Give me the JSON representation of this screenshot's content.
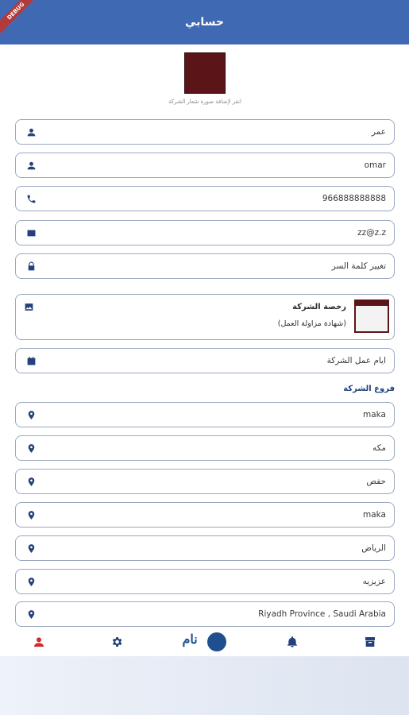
{
  "header": {
    "title": "حسابي",
    "debug_label": "DEBUG"
  },
  "logo": {
    "caption": "انقر لإضافة صورة شعار الشركة"
  },
  "fields": {
    "first_name": "عمر",
    "last_name": "omar",
    "phone": "966888888888",
    "email": "zz@z.z",
    "password_change": "تغيير كلمة السر",
    "work_days": "ايام عمل الشركة"
  },
  "license": {
    "title": "رخصة الشركة",
    "subtitle": "(شهادة مزاولة العمل)"
  },
  "branches": {
    "label": "فروع الشركة",
    "items": [
      "maka",
      "مكه",
      "حفص",
      "maka",
      "الرياض",
      "عزيزيه",
      "Riyadh Province , Saudi Arabia"
    ]
  },
  "nav": {
    "brand": "نام",
    "accent_color": "#d62828",
    "primary_color": "#23417a"
  },
  "icons": {
    "person": "person-icon",
    "phone": "phone-icon",
    "email": "email-icon",
    "lock": "lock-icon",
    "image": "image-icon",
    "calendar": "calendar-icon",
    "location": "location-pin-icon"
  }
}
